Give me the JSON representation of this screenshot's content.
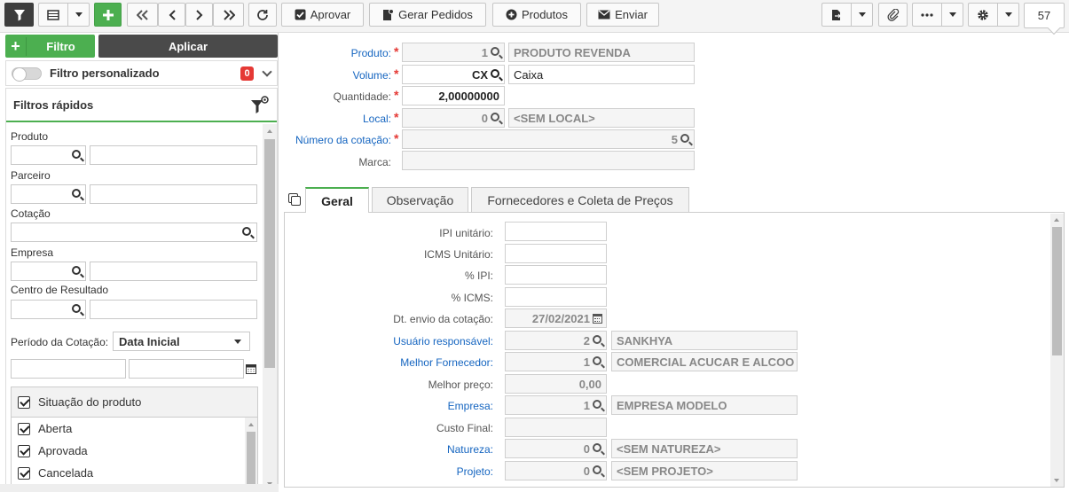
{
  "toolbar": {
    "aprovar": "Aprovar",
    "gerar_pedidos": "Gerar Pedidos",
    "produtos": "Produtos",
    "enviar": "Enviar",
    "record_count": "57"
  },
  "filter_panel": {
    "filtro_button": "Filtro",
    "aplicar_button": "Aplicar",
    "filtro_personalizado": "Filtro personalizado",
    "filtro_count": "0",
    "filtros_rapidos": "Filtros rápidos",
    "fields": {
      "produto": "Produto",
      "parceiro": "Parceiro",
      "cotacao": "Cotação",
      "empresa": "Empresa",
      "centro_resultado": "Centro de Resultado",
      "periodo_label": "Período da Cotação:",
      "periodo_select": "Data Inicial"
    },
    "situacao": {
      "title": "Situação do produto",
      "items": [
        "Aberta",
        "Aprovada",
        "Cancelada"
      ]
    }
  },
  "form": {
    "produto": {
      "label": "Produto:",
      "code": "1",
      "desc": "PRODUTO REVENDA"
    },
    "volume": {
      "label": "Volume:",
      "code": "CX",
      "desc": "Caixa"
    },
    "quantidade": {
      "label": "Quantidade:",
      "value": "2,00000000"
    },
    "local": {
      "label": "Local:",
      "code": "0",
      "desc": "<SEM LOCAL>"
    },
    "numero_cotacao": {
      "label": "Número da cotação:",
      "value": "5"
    },
    "marca": {
      "label": "Marca:",
      "value": ""
    }
  },
  "tabs": [
    "Geral",
    "Observação",
    "Fornecedores e Coleta de Preços"
  ],
  "geral": {
    "ipi_unitario": {
      "label": "IPI unitário:",
      "value": ""
    },
    "icms_unitario": {
      "label": "ICMS Unitário:",
      "value": ""
    },
    "pct_ipi": {
      "label": "% IPI:",
      "value": ""
    },
    "pct_icms": {
      "label": "% ICMS:",
      "value": ""
    },
    "dt_envio": {
      "label": "Dt. envio da cotação:",
      "value": "27/02/2021"
    },
    "usuario": {
      "label": "Usuário responsável:",
      "code": "2",
      "desc": "SANKHYA"
    },
    "melhor_fornecedor": {
      "label": "Melhor Fornecedor:",
      "code": "1",
      "desc": "COMERCIAL ACUCAR E ALCOO"
    },
    "melhor_preco": {
      "label": "Melhor preço:",
      "value": "0,00"
    },
    "empresa": {
      "label": "Empresa:",
      "code": "1",
      "desc": "EMPRESA MODELO"
    },
    "custo_final": {
      "label": "Custo Final:",
      "value": ""
    },
    "natureza": {
      "label": "Natureza:",
      "code": "0",
      "desc": "<SEM NATUREZA>"
    },
    "projeto": {
      "label": "Projeto:",
      "code": "0",
      "desc": "<SEM PROJETO>"
    }
  }
}
